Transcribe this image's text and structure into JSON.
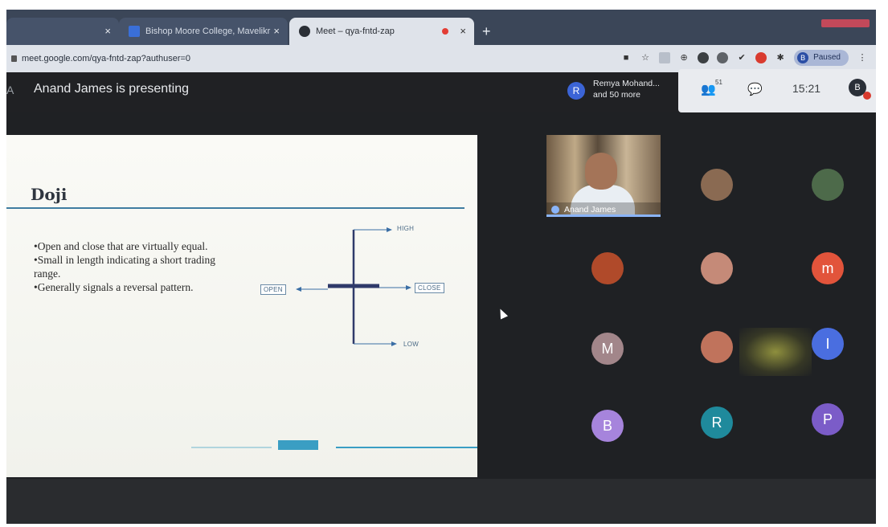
{
  "browser": {
    "tabs": [
      {
        "label": "",
        "active": false
      },
      {
        "label": "Bishop Moore College, Mavelikr",
        "active": false
      },
      {
        "label": "Meet – qya-fntd-zap",
        "active": true
      }
    ],
    "new_tab": "+",
    "close": "×",
    "url": "meet.google.com/qya-fntd-zap?authuser=0",
    "profile_status": "Paused",
    "profile_initial": "B"
  },
  "meet": {
    "presenting_title": "Anand James is presenting",
    "edge_char": "A",
    "presenters_avatar": "R",
    "presenters_line1": "Remya Mohand...",
    "presenters_line2": "and 50 more",
    "people_count": "51",
    "chat_badge": "",
    "time": "15:21",
    "user_initial": "B"
  },
  "slide": {
    "title": "Doji",
    "bullets": [
      "•Open and close that are virtually equal.",
      "•Small in length indicating a short trading range.",
      "•Generally signals a reversal pattern."
    ],
    "labels": {
      "high": "HIGH",
      "low": "LOW",
      "open": "OPEN",
      "close": "CLOSE"
    }
  },
  "participants": {
    "video_name": "Anand James",
    "tiles": [
      {
        "initial": "",
        "color": "#8a6a52",
        "kind": "photo"
      },
      {
        "initial": "",
        "color": "#4d6a4a",
        "kind": "photo"
      },
      {
        "initial": "",
        "color": "#b04a2a",
        "kind": "photo"
      },
      {
        "initial": "",
        "color": "#c58a78",
        "kind": "photo"
      },
      {
        "initial": "m",
        "color": "#e2543b",
        "kind": "letter"
      },
      {
        "initial": "M",
        "color": "#a2868a",
        "kind": "letter"
      },
      {
        "initial": "",
        "color": "#c0735c",
        "kind": "photo"
      },
      {
        "initial": "I",
        "color": "#4a6ee0",
        "kind": "letter"
      },
      {
        "initial": "B",
        "color": "#a684dc",
        "kind": "letter"
      },
      {
        "initial": "R",
        "color": "#1f8a9c",
        "kind": "letter"
      },
      {
        "initial": "P",
        "color": "#7b5cc8",
        "kind": "letter"
      }
    ]
  }
}
